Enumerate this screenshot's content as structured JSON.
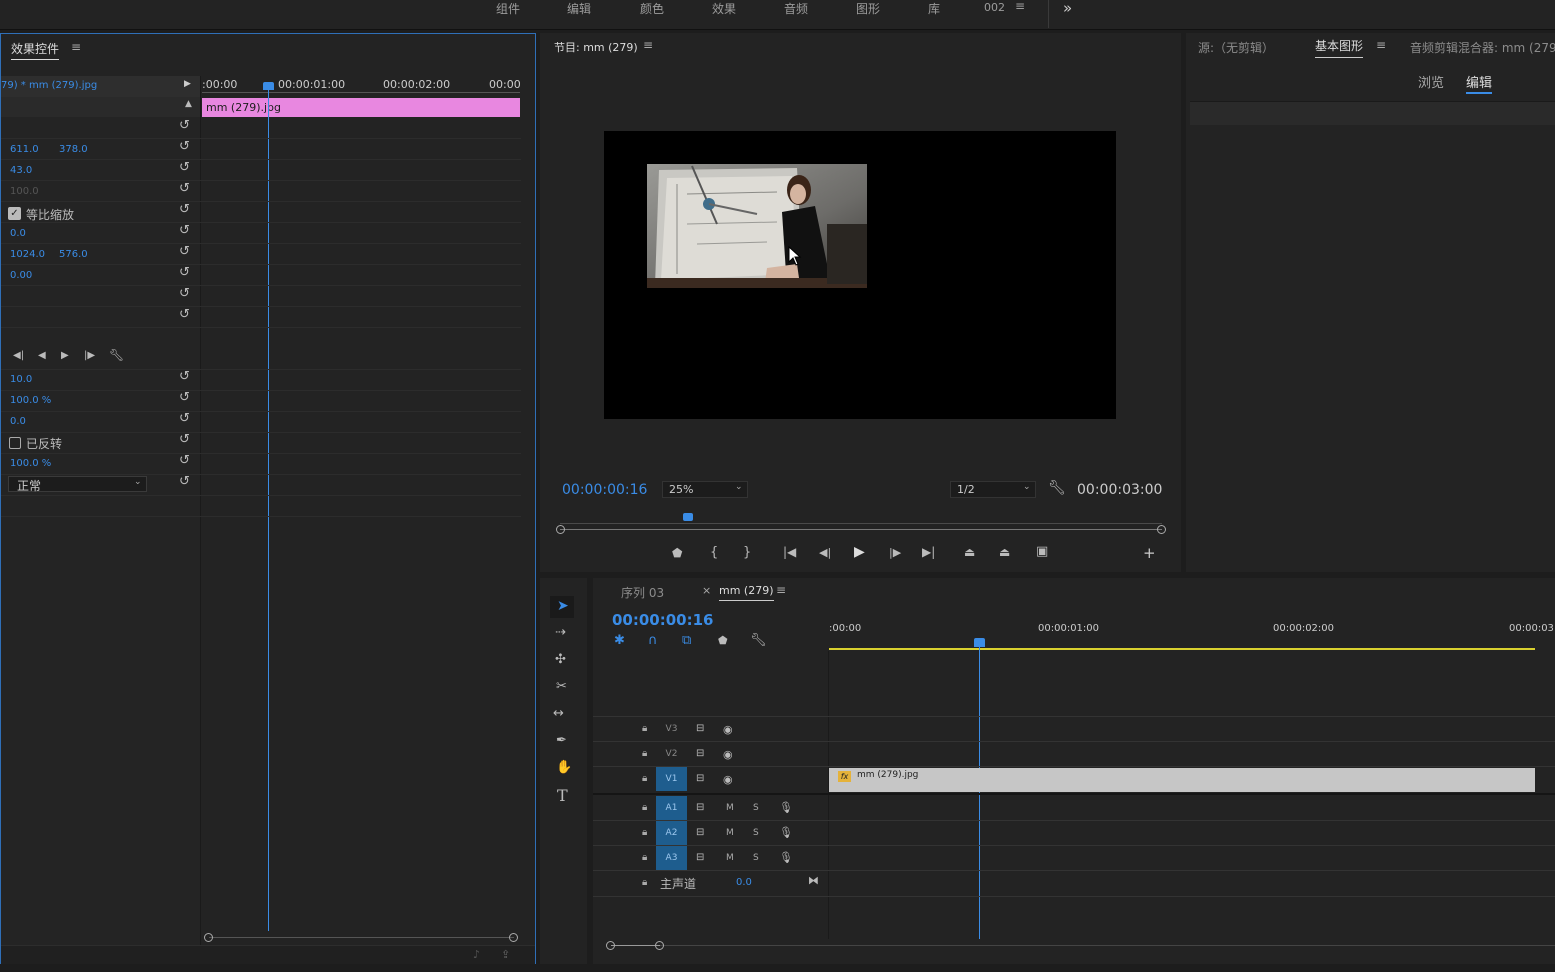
{
  "workspaces": {
    "items": [
      "组件",
      "编辑",
      "颜色",
      "效果",
      "音频",
      "图形",
      "库"
    ],
    "active": "002",
    "more": "»"
  },
  "effect_controls": {
    "tab": "效果控件",
    "clip_path": "79) * mm (279).jpg",
    "ruler_ticks": [
      ":00:00",
      "00:00:01:00",
      "00:00:02:00",
      "00:00"
    ],
    "clip_bar_label": "mm (279).jpg",
    "position_x": "611.0",
    "position_y": "378.0",
    "scale": "43.0",
    "scale_width": "100.0",
    "uniform_scale_label": "等比缩放",
    "rotation": "0.0",
    "anchor_x": "1024.0",
    "anchor_y": "576.0",
    "anti_flicker": "0.00",
    "feather": "10.0",
    "mask_opacity": "100.0 %",
    "mask_expansion": "0.0",
    "inverted_label": "已反转",
    "opacity": "100.0 %",
    "blend_mode": "正常"
  },
  "program_monitor": {
    "title": "节目: mm (279)",
    "timecode": "00:00:00:16",
    "zoom": "25%",
    "resolution": "1/2",
    "duration": "00:00:03:00"
  },
  "right_panel": {
    "tabs": [
      "源:（无剪辑）",
      "基本图形",
      "音频剪辑混合器: mm (279"
    ],
    "active_tab": "基本图形",
    "subtabs": [
      "浏览",
      "编辑"
    ],
    "active_subtab": "编辑"
  },
  "timeline": {
    "tabs": [
      "序列 03",
      "mm (279)"
    ],
    "active_tab": "mm (279)",
    "timecode": "00:00:00:16",
    "ruler_ticks": [
      ":00:00",
      "00:00:01:00",
      "00:00:02:00",
      "00:00:03:"
    ],
    "video_tracks": [
      "V3",
      "V2",
      "V1"
    ],
    "audio_tracks": [
      "A1",
      "A2",
      "A3"
    ],
    "clip_label": "mm (279).jpg",
    "fx_badge": "fx",
    "mute": "M",
    "solo": "S",
    "master_label": "主声道",
    "master_value": "0.0"
  },
  "colors": {
    "accent_blue": "#3a8ce6",
    "clip_pink": "#e887e0",
    "timeline_clip": "#c6c6c6",
    "work_area_yellow": "#d9d02f",
    "panel_bg": "#232323"
  }
}
